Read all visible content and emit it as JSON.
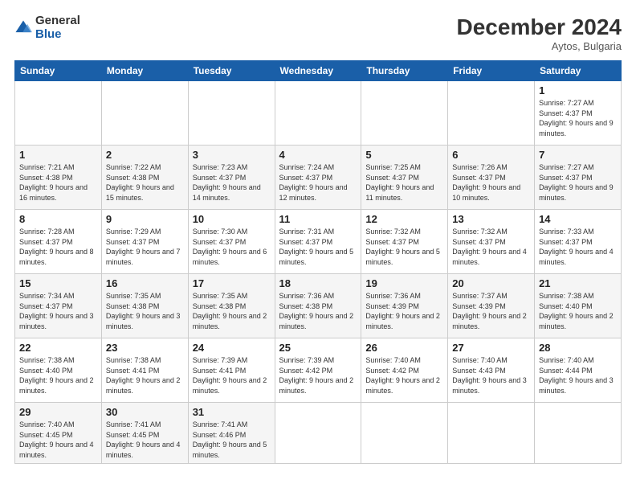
{
  "header": {
    "logo": {
      "general": "General",
      "blue": "Blue"
    },
    "title": "December 2024",
    "subtitle": "Aytos, Bulgaria"
  },
  "calendar": {
    "days_of_week": [
      "Sunday",
      "Monday",
      "Tuesday",
      "Wednesday",
      "Thursday",
      "Friday",
      "Saturday"
    ],
    "weeks": [
      [
        null,
        null,
        null,
        null,
        null,
        null,
        {
          "day": 1,
          "sunrise": "7:27 AM",
          "sunset": "4:37 PM",
          "daylight": "9 hours and 9 minutes."
        }
      ],
      [
        {
          "day": 1,
          "sunrise": "7:21 AM",
          "sunset": "4:38 PM",
          "daylight": "9 hours and 16 minutes."
        },
        {
          "day": 2,
          "sunrise": "7:22 AM",
          "sunset": "4:38 PM",
          "daylight": "9 hours and 15 minutes."
        },
        {
          "day": 3,
          "sunrise": "7:23 AM",
          "sunset": "4:37 PM",
          "daylight": "9 hours and 14 minutes."
        },
        {
          "day": 4,
          "sunrise": "7:24 AM",
          "sunset": "4:37 PM",
          "daylight": "9 hours and 12 minutes."
        },
        {
          "day": 5,
          "sunrise": "7:25 AM",
          "sunset": "4:37 PM",
          "daylight": "9 hours and 11 minutes."
        },
        {
          "day": 6,
          "sunrise": "7:26 AM",
          "sunset": "4:37 PM",
          "daylight": "9 hours and 10 minutes."
        },
        {
          "day": 7,
          "sunrise": "7:27 AM",
          "sunset": "4:37 PM",
          "daylight": "9 hours and 9 minutes."
        }
      ],
      [
        {
          "day": 8,
          "sunrise": "7:28 AM",
          "sunset": "4:37 PM",
          "daylight": "9 hours and 8 minutes."
        },
        {
          "day": 9,
          "sunrise": "7:29 AM",
          "sunset": "4:37 PM",
          "daylight": "9 hours and 7 minutes."
        },
        {
          "day": 10,
          "sunrise": "7:30 AM",
          "sunset": "4:37 PM",
          "daylight": "9 hours and 6 minutes."
        },
        {
          "day": 11,
          "sunrise": "7:31 AM",
          "sunset": "4:37 PM",
          "daylight": "9 hours and 5 minutes."
        },
        {
          "day": 12,
          "sunrise": "7:32 AM",
          "sunset": "4:37 PM",
          "daylight": "9 hours and 5 minutes."
        },
        {
          "day": 13,
          "sunrise": "7:32 AM",
          "sunset": "4:37 PM",
          "daylight": "9 hours and 4 minutes."
        },
        {
          "day": 14,
          "sunrise": "7:33 AM",
          "sunset": "4:37 PM",
          "daylight": "9 hours and 4 minutes."
        }
      ],
      [
        {
          "day": 15,
          "sunrise": "7:34 AM",
          "sunset": "4:37 PM",
          "daylight": "9 hours and 3 minutes."
        },
        {
          "day": 16,
          "sunrise": "7:35 AM",
          "sunset": "4:38 PM",
          "daylight": "9 hours and 3 minutes."
        },
        {
          "day": 17,
          "sunrise": "7:35 AM",
          "sunset": "4:38 PM",
          "daylight": "9 hours and 2 minutes."
        },
        {
          "day": 18,
          "sunrise": "7:36 AM",
          "sunset": "4:38 PM",
          "daylight": "9 hours and 2 minutes."
        },
        {
          "day": 19,
          "sunrise": "7:36 AM",
          "sunset": "4:39 PM",
          "daylight": "9 hours and 2 minutes."
        },
        {
          "day": 20,
          "sunrise": "7:37 AM",
          "sunset": "4:39 PM",
          "daylight": "9 hours and 2 minutes."
        },
        {
          "day": 21,
          "sunrise": "7:38 AM",
          "sunset": "4:40 PM",
          "daylight": "9 hours and 2 minutes."
        }
      ],
      [
        {
          "day": 22,
          "sunrise": "7:38 AM",
          "sunset": "4:40 PM",
          "daylight": "9 hours and 2 minutes."
        },
        {
          "day": 23,
          "sunrise": "7:38 AM",
          "sunset": "4:41 PM",
          "daylight": "9 hours and 2 minutes."
        },
        {
          "day": 24,
          "sunrise": "7:39 AM",
          "sunset": "4:41 PM",
          "daylight": "9 hours and 2 minutes."
        },
        {
          "day": 25,
          "sunrise": "7:39 AM",
          "sunset": "4:42 PM",
          "daylight": "9 hours and 2 minutes."
        },
        {
          "day": 26,
          "sunrise": "7:40 AM",
          "sunset": "4:42 PM",
          "daylight": "9 hours and 2 minutes."
        },
        {
          "day": 27,
          "sunrise": "7:40 AM",
          "sunset": "4:43 PM",
          "daylight": "9 hours and 3 minutes."
        },
        {
          "day": 28,
          "sunrise": "7:40 AM",
          "sunset": "4:44 PM",
          "daylight": "9 hours and 3 minutes."
        }
      ],
      [
        {
          "day": 29,
          "sunrise": "7:40 AM",
          "sunset": "4:45 PM",
          "daylight": "9 hours and 4 minutes."
        },
        {
          "day": 30,
          "sunrise": "7:41 AM",
          "sunset": "4:45 PM",
          "daylight": "9 hours and 4 minutes."
        },
        {
          "day": 31,
          "sunrise": "7:41 AM",
          "sunset": "4:46 PM",
          "daylight": "9 hours and 5 minutes."
        },
        null,
        null,
        null,
        null
      ]
    ],
    "labels": {
      "sunrise": "Sunrise:",
      "sunset": "Sunset:",
      "daylight": "Daylight:"
    }
  }
}
